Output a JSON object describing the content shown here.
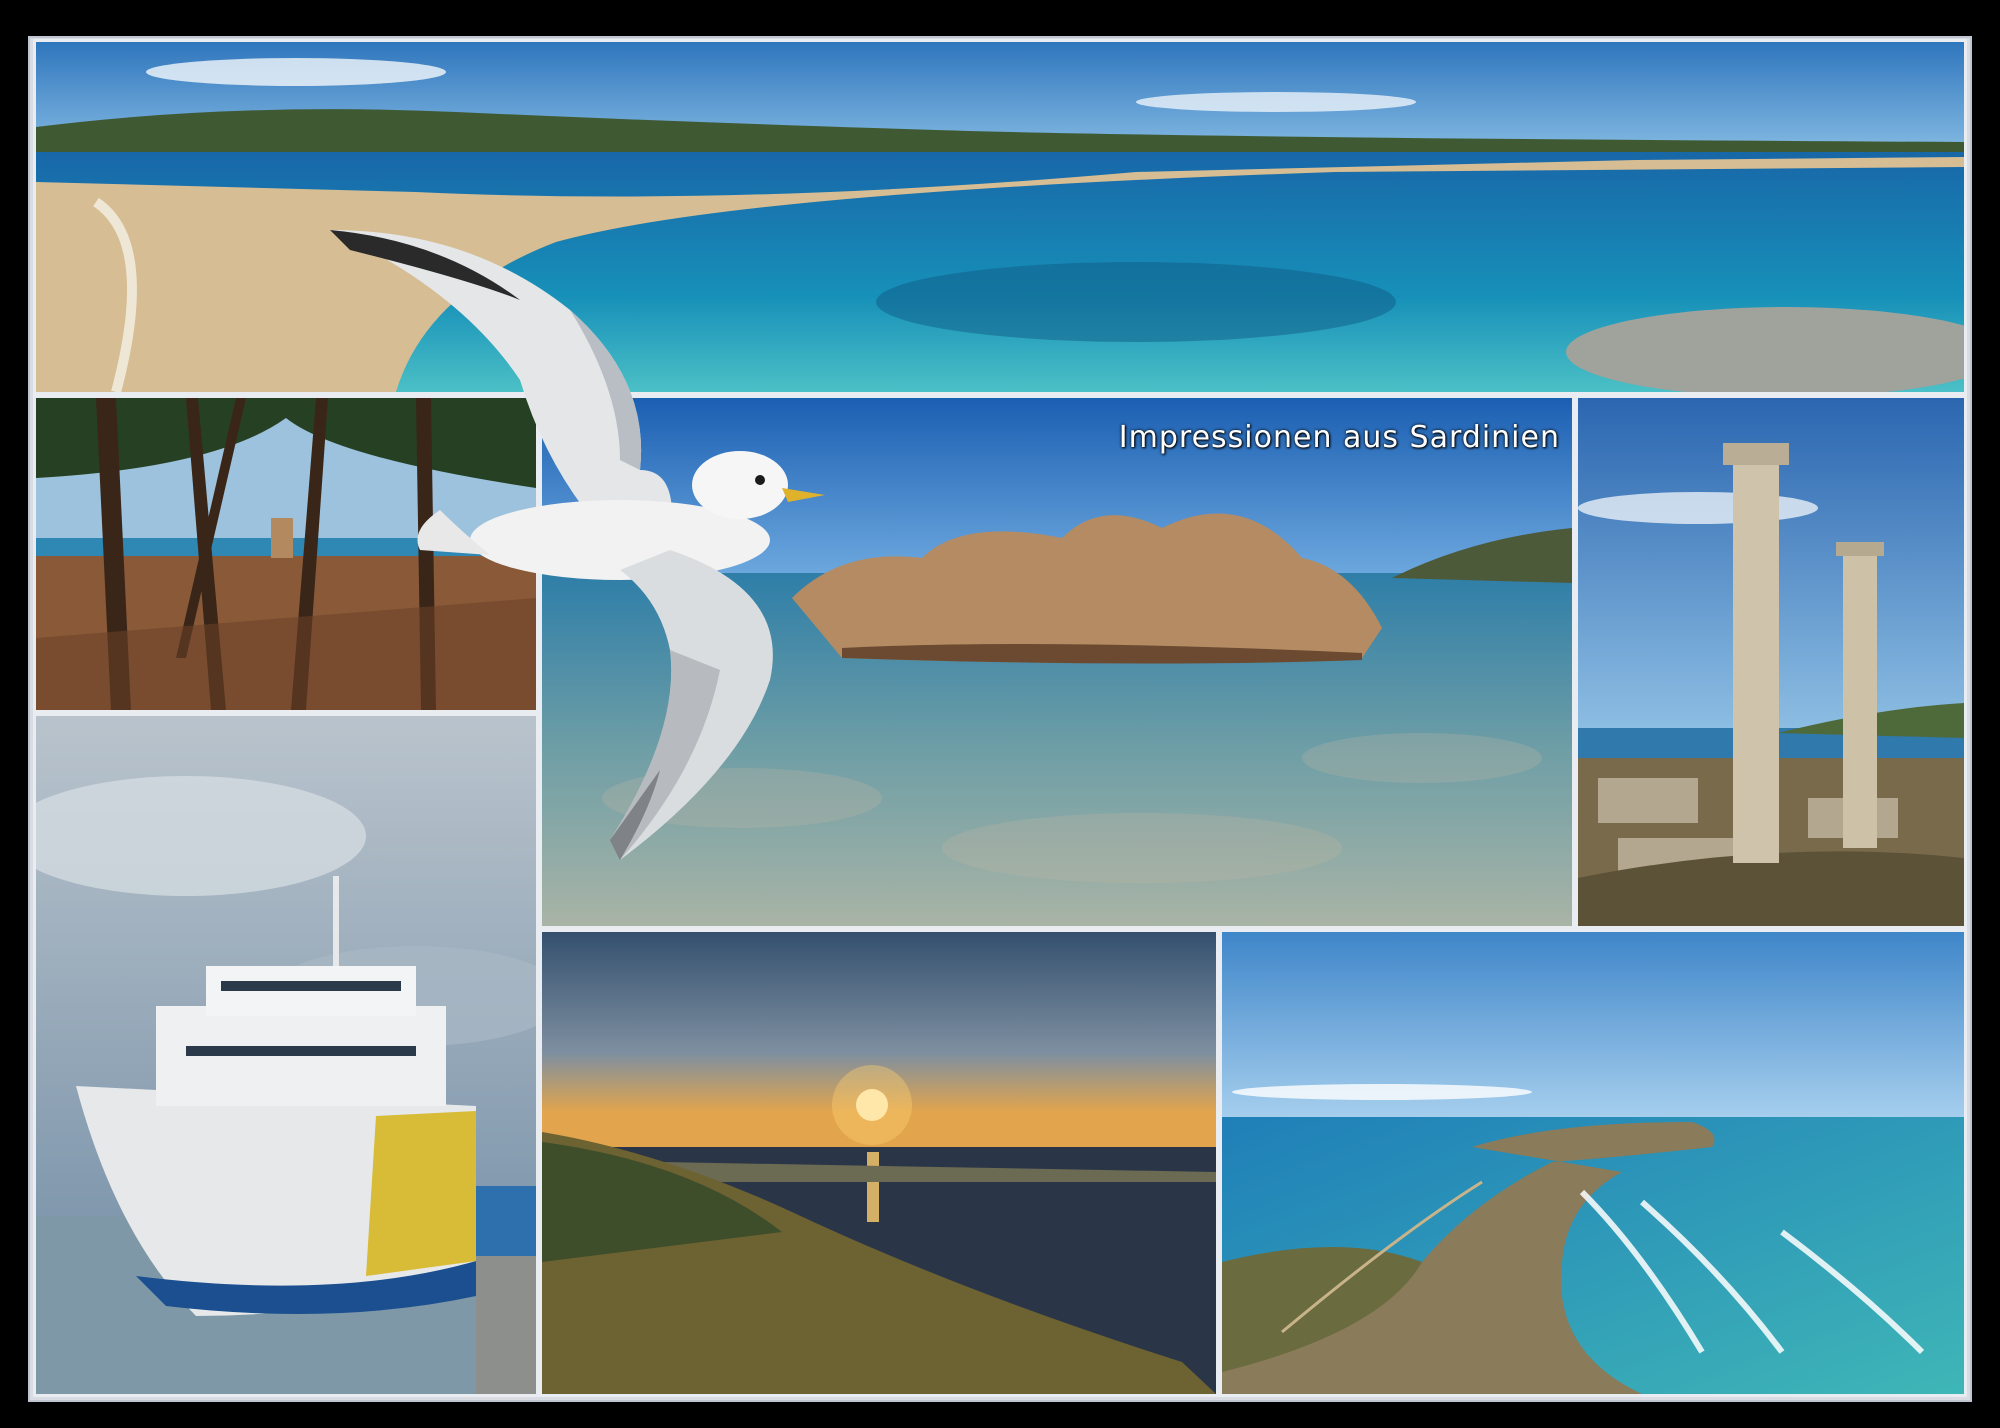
{
  "collage": {
    "title": "Impressionen aus Sardinien",
    "photos": [
      {
        "id": "beach-panorama",
        "subject": "sandy bay with turquoise sea"
      },
      {
        "id": "pine-grove",
        "subject": "pine trees and coastal tower"
      },
      {
        "id": "rocky-cove",
        "subject": "rocks in clear shallow water"
      },
      {
        "id": "roman-columns",
        "subject": "ancient columns of ruins"
      },
      {
        "id": "ferry",
        "subject": "ferry ship in harbour"
      },
      {
        "id": "sunset",
        "subject": "sunset over lagoon"
      },
      {
        "id": "cape-aerial",
        "subject": "peninsula with surf"
      }
    ],
    "colors": {
      "frame": "#000000",
      "sea": "#1f7fb8",
      "sky": "#3f86c9",
      "sand": "#d6bd93"
    }
  }
}
